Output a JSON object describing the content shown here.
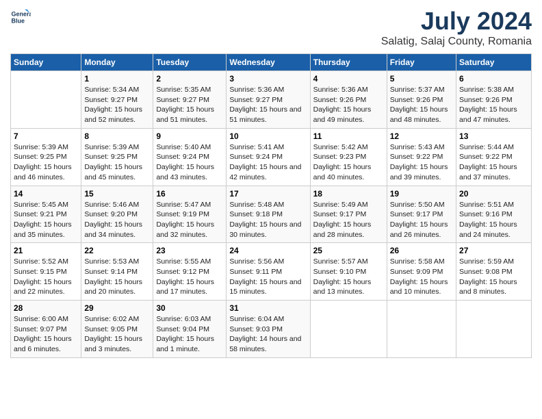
{
  "logo": {
    "line1": "General",
    "line2": "Blue"
  },
  "title": "July 2024",
  "subtitle": "Salatig, Salaj County, Romania",
  "header": {
    "colors": {
      "accent": "#1a5fa8"
    }
  },
  "days_of_week": [
    "Sunday",
    "Monday",
    "Tuesday",
    "Wednesday",
    "Thursday",
    "Friday",
    "Saturday"
  ],
  "weeks": [
    [
      {
        "day": "",
        "info": ""
      },
      {
        "day": "1",
        "info": "Sunrise: 5:34 AM\nSunset: 9:27 PM\nDaylight: 15 hours\nand 52 minutes."
      },
      {
        "day": "2",
        "info": "Sunrise: 5:35 AM\nSunset: 9:27 PM\nDaylight: 15 hours\nand 51 minutes."
      },
      {
        "day": "3",
        "info": "Sunrise: 5:36 AM\nSunset: 9:27 PM\nDaylight: 15 hours\nand 51 minutes."
      },
      {
        "day": "4",
        "info": "Sunrise: 5:36 AM\nSunset: 9:26 PM\nDaylight: 15 hours\nand 49 minutes."
      },
      {
        "day": "5",
        "info": "Sunrise: 5:37 AM\nSunset: 9:26 PM\nDaylight: 15 hours\nand 48 minutes."
      },
      {
        "day": "6",
        "info": "Sunrise: 5:38 AM\nSunset: 9:26 PM\nDaylight: 15 hours\nand 47 minutes."
      }
    ],
    [
      {
        "day": "7",
        "info": "Sunrise: 5:39 AM\nSunset: 9:25 PM\nDaylight: 15 hours\nand 46 minutes."
      },
      {
        "day": "8",
        "info": "Sunrise: 5:39 AM\nSunset: 9:25 PM\nDaylight: 15 hours\nand 45 minutes."
      },
      {
        "day": "9",
        "info": "Sunrise: 5:40 AM\nSunset: 9:24 PM\nDaylight: 15 hours\nand 43 minutes."
      },
      {
        "day": "10",
        "info": "Sunrise: 5:41 AM\nSunset: 9:24 PM\nDaylight: 15 hours\nand 42 minutes."
      },
      {
        "day": "11",
        "info": "Sunrise: 5:42 AM\nSunset: 9:23 PM\nDaylight: 15 hours\nand 40 minutes."
      },
      {
        "day": "12",
        "info": "Sunrise: 5:43 AM\nSunset: 9:22 PM\nDaylight: 15 hours\nand 39 minutes."
      },
      {
        "day": "13",
        "info": "Sunrise: 5:44 AM\nSunset: 9:22 PM\nDaylight: 15 hours\nand 37 minutes."
      }
    ],
    [
      {
        "day": "14",
        "info": "Sunrise: 5:45 AM\nSunset: 9:21 PM\nDaylight: 15 hours\nand 35 minutes."
      },
      {
        "day": "15",
        "info": "Sunrise: 5:46 AM\nSunset: 9:20 PM\nDaylight: 15 hours\nand 34 minutes."
      },
      {
        "day": "16",
        "info": "Sunrise: 5:47 AM\nSunset: 9:19 PM\nDaylight: 15 hours\nand 32 minutes."
      },
      {
        "day": "17",
        "info": "Sunrise: 5:48 AM\nSunset: 9:18 PM\nDaylight: 15 hours\nand 30 minutes."
      },
      {
        "day": "18",
        "info": "Sunrise: 5:49 AM\nSunset: 9:17 PM\nDaylight: 15 hours\nand 28 minutes."
      },
      {
        "day": "19",
        "info": "Sunrise: 5:50 AM\nSunset: 9:17 PM\nDaylight: 15 hours\nand 26 minutes."
      },
      {
        "day": "20",
        "info": "Sunrise: 5:51 AM\nSunset: 9:16 PM\nDaylight: 15 hours\nand 24 minutes."
      }
    ],
    [
      {
        "day": "21",
        "info": "Sunrise: 5:52 AM\nSunset: 9:15 PM\nDaylight: 15 hours\nand 22 minutes."
      },
      {
        "day": "22",
        "info": "Sunrise: 5:53 AM\nSunset: 9:14 PM\nDaylight: 15 hours\nand 20 minutes."
      },
      {
        "day": "23",
        "info": "Sunrise: 5:55 AM\nSunset: 9:12 PM\nDaylight: 15 hours\nand 17 minutes."
      },
      {
        "day": "24",
        "info": "Sunrise: 5:56 AM\nSunset: 9:11 PM\nDaylight: 15 hours\nand 15 minutes."
      },
      {
        "day": "25",
        "info": "Sunrise: 5:57 AM\nSunset: 9:10 PM\nDaylight: 15 hours\nand 13 minutes."
      },
      {
        "day": "26",
        "info": "Sunrise: 5:58 AM\nSunset: 9:09 PM\nDaylight: 15 hours\nand 10 minutes."
      },
      {
        "day": "27",
        "info": "Sunrise: 5:59 AM\nSunset: 9:08 PM\nDaylight: 15 hours\nand 8 minutes."
      }
    ],
    [
      {
        "day": "28",
        "info": "Sunrise: 6:00 AM\nSunset: 9:07 PM\nDaylight: 15 hours\nand 6 minutes."
      },
      {
        "day": "29",
        "info": "Sunrise: 6:02 AM\nSunset: 9:05 PM\nDaylight: 15 hours\nand 3 minutes."
      },
      {
        "day": "30",
        "info": "Sunrise: 6:03 AM\nSunset: 9:04 PM\nDaylight: 15 hours\nand 1 minute."
      },
      {
        "day": "31",
        "info": "Sunrise: 6:04 AM\nSunset: 9:03 PM\nDaylight: 14 hours\nand 58 minutes."
      },
      {
        "day": "",
        "info": ""
      },
      {
        "day": "",
        "info": ""
      },
      {
        "day": "",
        "info": ""
      }
    ]
  ]
}
